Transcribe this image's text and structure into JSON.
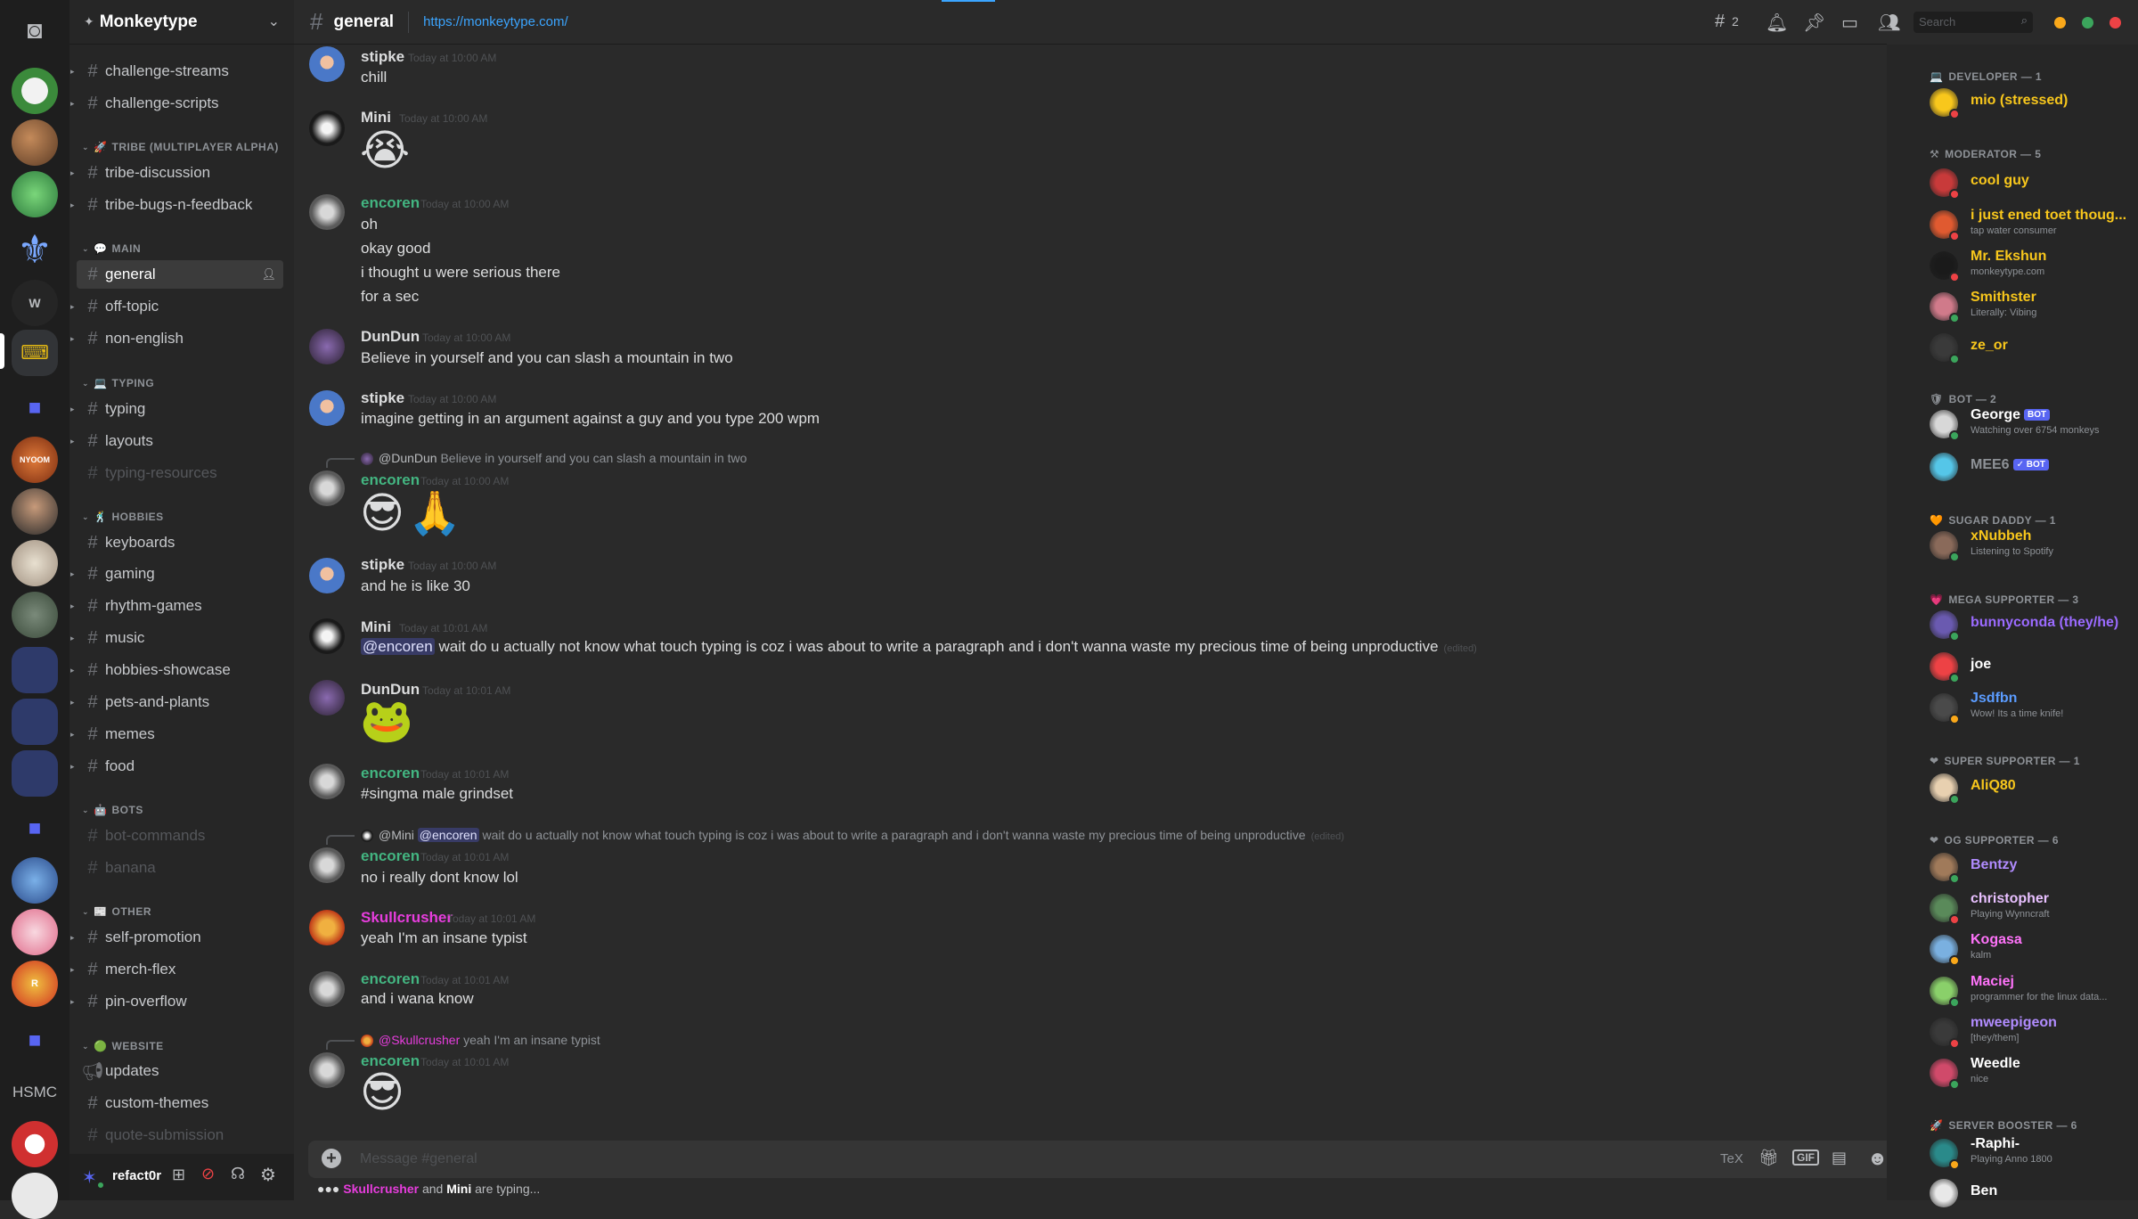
{
  "guild": {
    "name": "Monkeytype"
  },
  "rail": {
    "text_item_w": "W",
    "text_item_hsmc": "HSMC"
  },
  "sidebar": {
    "channels_top": [
      "challenge-streams",
      "challenge-scripts"
    ],
    "cat_tribe": "TRIBE (MULTIPLAYER ALPHA)",
    "tribe": [
      "tribe-discussion",
      "tribe-bugs-n-feedback"
    ],
    "cat_main": "MAIN",
    "main": [
      "general",
      "off-topic",
      "non-english"
    ],
    "cat_typing": "TYPING",
    "typing": [
      "typing",
      "layouts",
      "typing-resources"
    ],
    "cat_hobbies": "HOBBIES",
    "hobbies": [
      "keyboards",
      "gaming",
      "rhythm-games",
      "music",
      "hobbies-showcase",
      "pets-and-plants",
      "memes",
      "food"
    ],
    "cat_bots": "BOTS",
    "bots": [
      "bot-commands",
      "banana"
    ],
    "cat_other": "OTHER",
    "other": [
      "self-promotion",
      "merch-flex",
      "pin-overflow"
    ],
    "cat_website": "WEBSITE",
    "website": [
      "updates",
      "custom-themes",
      "quote-submission"
    ]
  },
  "user": {
    "name": "refact0r"
  },
  "header": {
    "channel": "general",
    "topic": "https://monkeytype.com/",
    "thread_count": "2",
    "search_placeholder": "Search"
  },
  "messages": [
    {
      "author": "stipke",
      "time": "Today at 10:00 AM",
      "lines": [
        "chill"
      ]
    },
    {
      "author": "Mini",
      "time": "Today at 10:00 AM",
      "emoji": [
        "😭"
      ]
    },
    {
      "author": "encoren",
      "time": "Today at 10:00 AM",
      "lines": [
        "oh",
        "okay good",
        "i thought u were serious there",
        "for a sec"
      ]
    },
    {
      "author": "DunDun",
      "time": "Today at 10:00 AM",
      "lines": [
        "Believe in yourself and you can slash a mountain in two"
      ]
    },
    {
      "author": "stipke",
      "time": "Today at 10:00 AM",
      "lines": [
        "imagine getting in an argument against a guy and you type 200 wpm"
      ]
    },
    {
      "author": "encoren",
      "time": "Today at 10:00 AM",
      "reply_name": "@DunDun",
      "reply_text": "Believe in yourself and you can slash a mountain in two",
      "emoji": [
        "😎",
        "🙏"
      ]
    },
    {
      "author": "stipke",
      "time": "Today at 10:00 AM",
      "lines": [
        "and he is like 30"
      ]
    },
    {
      "author": "Mini",
      "time": "Today at 10:01 AM",
      "mention": "@encoren",
      "lines": [
        "wait do u actually not know what touch typing is coz i was about to write a paragraph and i don't wanna waste my precious time of being unproductive"
      ],
      "edited": "(edited)"
    },
    {
      "author": "DunDun",
      "time": "Today at 10:01 AM",
      "emoji": [
        "🐸"
      ]
    },
    {
      "author": "encoren",
      "time": "Today at 10:01 AM",
      "lines": [
        "#singma male grindset"
      ]
    },
    {
      "author": "encoren",
      "time": "Today at 10:01 AM",
      "reply_name": "@Mini",
      "reply_mention": "@encoren",
      "reply_text": "wait do u actually not know what touch typing is coz i was about to write a paragraph and i don't wanna waste my precious time of being unproductive",
      "reply_edited": "(edited)",
      "lines": [
        "no i really dont know lol"
      ]
    },
    {
      "author": "Skullcrusher",
      "time": "Today at 10:01 AM",
      "lines": [
        "yeah I'm an insane typist"
      ]
    },
    {
      "author": "encoren",
      "time": "Today at 10:01 AM",
      "lines": [
        "and i wana know"
      ]
    },
    {
      "author": "encoren",
      "time": "Today at 10:01 AM",
      "reply_name": "@Skullcrusher",
      "reply_text": "yeah I'm an insane typist",
      "emoji": [
        "😎"
      ]
    }
  ],
  "composer": {
    "placeholder": "Message #general",
    "tex": "TeX",
    "gif": "GIF"
  },
  "typing": {
    "user1": "Skullcrusher",
    "and": "and",
    "user2": "Mini",
    "suffix": "are typing..."
  },
  "members": {
    "roles": [
      "DEVELOPER — 1",
      "MODERATOR — 5",
      "BOT — 2",
      "SUGAR DADDY — 1",
      "MEGA SUPPORTER — 3",
      "SUPER SUPPORTER — 1",
      "OG SUPPORTER — 6",
      "SERVER BOOSTER — 6"
    ],
    "list": [
      {
        "name": "mio (stressed)",
        "sub": ""
      },
      {
        "name": "cool guy",
        "sub": ""
      },
      {
        "name": "i just ened toet thoug...",
        "sub": "tap water consumer"
      },
      {
        "name": "Mr. Ekshun",
        "sub": "monkeytype.com"
      },
      {
        "name": "Smithster",
        "sub": "Literally: Vibing"
      },
      {
        "name": "ze_or",
        "sub": ""
      },
      {
        "name": "George",
        "sub": "Watching over 6754 monkeys",
        "tag": "BOT"
      },
      {
        "name": "MEE6",
        "sub": "",
        "tag": "✓ BOT"
      },
      {
        "name": "xNubbeh",
        "sub": "Listening to Spotify"
      },
      {
        "name": "bunnyconda (they/he)",
        "sub": ""
      },
      {
        "name": "joe",
        "sub": ""
      },
      {
        "name": "Jsdfbn",
        "sub": "Wow! Its a time knife!"
      },
      {
        "name": "AliQ80",
        "sub": ""
      },
      {
        "name": "Bentzy",
        "sub": ""
      },
      {
        "name": "christopher",
        "sub": "Playing Wynncraft"
      },
      {
        "name": "Kogasa",
        "sub": "kalm"
      },
      {
        "name": "Maciej",
        "sub": "programmer for the linux data..."
      },
      {
        "name": "mweepigeon",
        "sub": "[they/them]"
      },
      {
        "name": "Weedle",
        "sub": "nice"
      },
      {
        "name": "-Raphi-",
        "sub": "Playing Anno 1800"
      },
      {
        "name": "Ben",
        "sub": ""
      }
    ]
  },
  "colors": {
    "accent": "#5865f2",
    "online": "#3ba55c",
    "dnd": "#ed4245",
    "idle": "#faa81a",
    "link": "#3ba5ff",
    "encoren": "#43b581",
    "skull": "#e73ddd"
  }
}
